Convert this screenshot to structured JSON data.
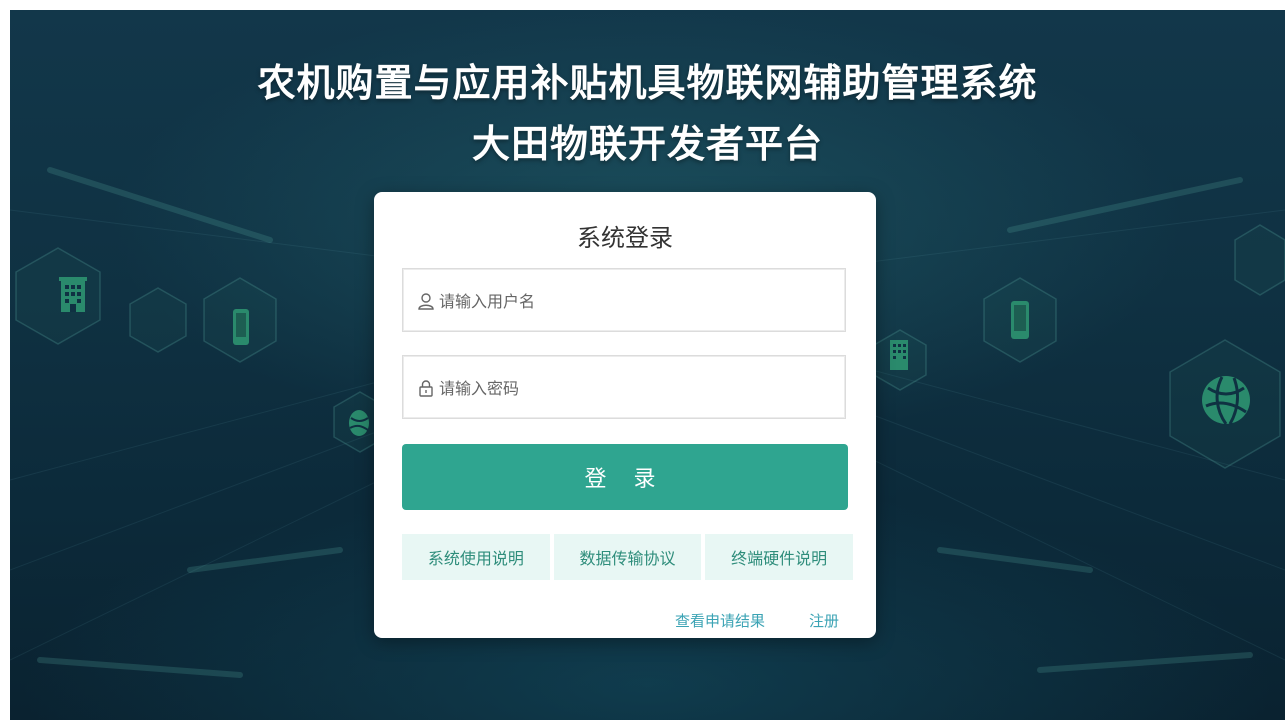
{
  "header": {
    "title_line1": "农机购置与应用补贴机具物联网辅助管理系统",
    "title_line2": "大田物联开发者平台"
  },
  "login": {
    "title": "系统登录",
    "username_placeholder": "请输入用户名",
    "password_placeholder": "请输入密码",
    "login_button": "登 录",
    "links": [
      "系统使用说明",
      "数据传输协议",
      "终端硬件说明"
    ],
    "view_result": "查看申请结果",
    "register": "注册"
  },
  "colors": {
    "accent": "#2fa590",
    "link": "#3ba3b4",
    "link_button_bg": "#e8f7f4",
    "background": "#0f3142"
  },
  "icons": {
    "username": "user-icon",
    "password": "lock-icon",
    "decor": [
      "building-icon",
      "phone-icon",
      "globe-icon"
    ]
  }
}
